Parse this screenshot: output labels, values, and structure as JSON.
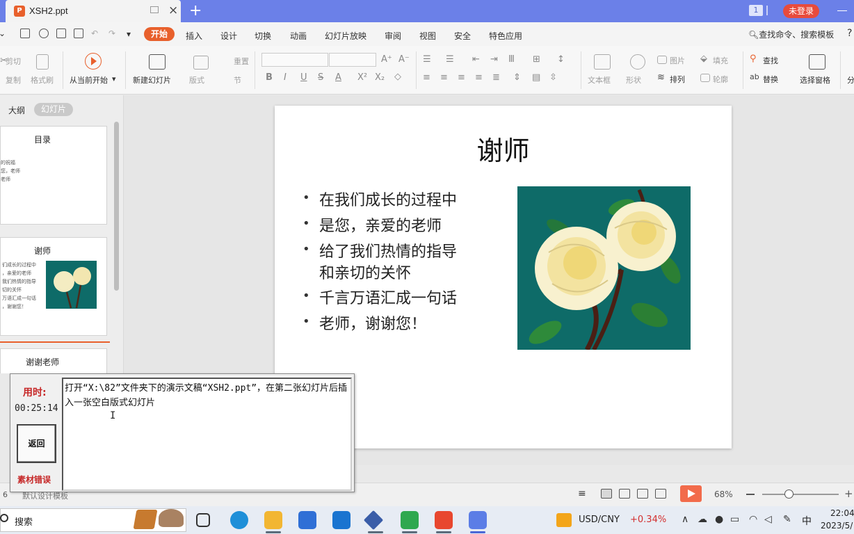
{
  "tab": {
    "title": "XSH2.ppt",
    "logo": "P",
    "new_tab": "+"
  },
  "window": {
    "user_count": "1",
    "login_label": "未登录"
  },
  "menu": {
    "items": [
      "开始",
      "插入",
      "设计",
      "切换",
      "动画",
      "幻灯片放映",
      "审阅",
      "视图",
      "安全",
      "特色应用"
    ],
    "search_label": "查找命令、搜索模板",
    "help": "?"
  },
  "ribbon": {
    "cut": "剪切",
    "copy": "复制",
    "format_painter": "格式刷",
    "from_current": "从当前开始",
    "new_slide": "新建幻灯片",
    "layout": "版式",
    "reset": "重置",
    "section": "节",
    "textbox": "文本框",
    "shape": "形状",
    "picture": "图片",
    "fill": "填充",
    "arrange": "排列",
    "outline": "轮廓",
    "find": "查找",
    "replace": "替换",
    "selection_pane": "选择窗格",
    "more": "分",
    "font_buttons": [
      "B",
      "I",
      "U",
      "S",
      "A",
      "X²",
      "X₂"
    ]
  },
  "left_panel": {
    "tabs": {
      "outline": "大纲",
      "slides": "幻灯片"
    },
    "thumbnails": [
      {
        "title": "目录",
        "lines": [
          "的祝福",
          "您，老师",
          "老师"
        ]
      },
      {
        "title": "谢师",
        "lines": [
          "们成长的过程中",
          "，亲爱的老师",
          "我们热情的指导",
          "切的关怀",
          "万语汇成一句话",
          "，谢谢您！"
        ]
      },
      {
        "title": "谢谢老师",
        "lines": []
      }
    ]
  },
  "slide": {
    "title": "谢师",
    "bullets": [
      "在我们成长的过程中",
      "是您，亲爱的老师",
      "给了我们热情的指导",
      "和亲切的关怀",
      "千言万语汇成一句话",
      "老师，谢谢您！"
    ],
    "bullet_mark": "•",
    "image": "rose-picture",
    "image_bg": "#0e6b68"
  },
  "status": {
    "slide_number": "6",
    "template": "默认设计模板",
    "zoom": "68%",
    "zoom_minus": "−",
    "zoom_plus": "+",
    "zoom_fraction": 0.35
  },
  "task_dialog": {
    "time_label": "用时:",
    "time_value": "00:25:14",
    "back_button": "返回",
    "material_error": "素材错误",
    "instruction": "打开“X:\\82”文件夹下的演示文稿“XSH2.ppt”，在第二张幻灯片后插入一张空白版式幻灯片",
    "cursor": "I"
  },
  "taskbar": {
    "search_label": "搜索",
    "ticker_name": "USD/CNY",
    "ticker_change": "+0.34%",
    "ime": "中",
    "clock_time": "22:04",
    "clock_date": "2023/5/"
  },
  "colors": {
    "accent": "#e8602c",
    "tabbar": "#6b80e8",
    "login": "#e84b3c",
    "error_red": "#c62828"
  }
}
